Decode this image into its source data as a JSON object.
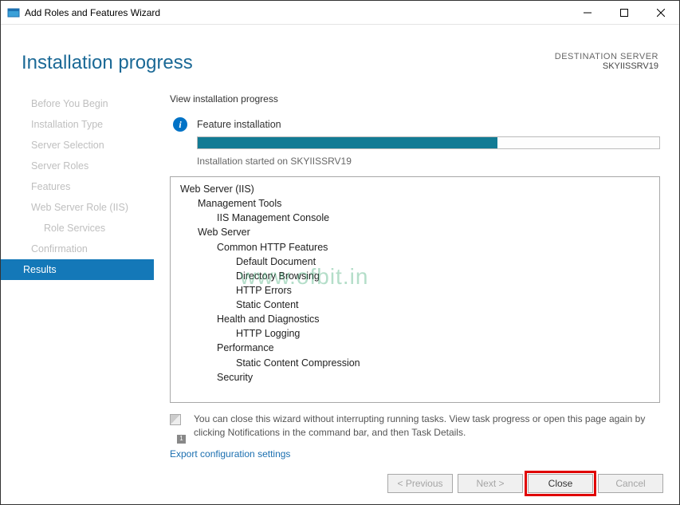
{
  "window": {
    "title": "Add Roles and Features Wizard"
  },
  "header": {
    "page_title": "Installation progress",
    "dest_label": "DESTINATION SERVER",
    "dest_server": "SKYIISSRV19"
  },
  "sidebar": {
    "steps": [
      "Before You Begin",
      "Installation Type",
      "Server Selection",
      "Server Roles",
      "Features",
      "Web Server Role (IIS)",
      "Role Services",
      "Confirmation",
      "Results"
    ],
    "active_index": 8,
    "sub_indices": [
      6
    ]
  },
  "content": {
    "instruction": "View installation progress",
    "status_label": "Feature installation",
    "progress_percent": 65,
    "started_text": "Installation started on SKYIISSRV19",
    "tree": [
      {
        "level": 0,
        "text": "Web Server (IIS)"
      },
      {
        "level": 1,
        "text": "Management Tools"
      },
      {
        "level": 2,
        "text": "IIS Management Console"
      },
      {
        "level": 1,
        "text": "Web Server"
      },
      {
        "level": 2,
        "text": "Common HTTP Features"
      },
      {
        "level": 3,
        "text": "Default Document"
      },
      {
        "level": 3,
        "text": "Directory Browsing"
      },
      {
        "level": 3,
        "text": "HTTP Errors"
      },
      {
        "level": 3,
        "text": "Static Content"
      },
      {
        "level": 2,
        "text": "Health and Diagnostics"
      },
      {
        "level": 3,
        "text": "HTTP Logging"
      },
      {
        "level": 2,
        "text": "Performance"
      },
      {
        "level": 3,
        "text": "Static Content Compression"
      },
      {
        "level": 2,
        "text": "Security"
      }
    ],
    "footer_note": "You can close this wizard without interrupting running tasks. View task progress or open this page again by clicking Notifications in the command bar, and then Task Details.",
    "footer_badge": "1",
    "export_link": "Export configuration settings"
  },
  "buttons": {
    "previous": "< Previous",
    "next": "Next >",
    "close": "Close",
    "cancel": "Cancel"
  },
  "watermark": "www.ofbit.in"
}
